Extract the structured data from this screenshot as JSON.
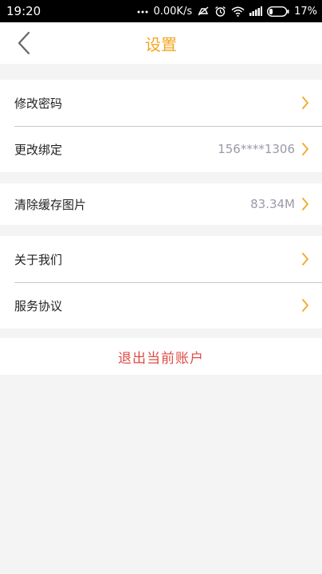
{
  "status_bar": {
    "time": "19:20",
    "network_speed": "0.00K/s",
    "battery_percent": "17%",
    "icons": [
      "dots-icon",
      "mute-icon",
      "alarm-icon",
      "wifi-icon",
      "signal-icon",
      "battery-icon"
    ]
  },
  "header": {
    "title": "设置",
    "back_icon": "chevron-left-icon"
  },
  "account_group": {
    "items": [
      {
        "label": "修改密码",
        "value": ""
      },
      {
        "label": "更改绑定",
        "value": "156****1306"
      }
    ]
  },
  "cache_group": {
    "items": [
      {
        "label": "清除缓存图片",
        "value": "83.34M"
      }
    ]
  },
  "about_group": {
    "items": [
      {
        "label": "关于我们",
        "value": ""
      },
      {
        "label": "服务协议",
        "value": ""
      }
    ]
  },
  "logout": {
    "label": "退出当前账户"
  },
  "colors": {
    "accent": "#f5a623",
    "danger": "#e04b43",
    "muted_text": "#9a9aa8"
  }
}
